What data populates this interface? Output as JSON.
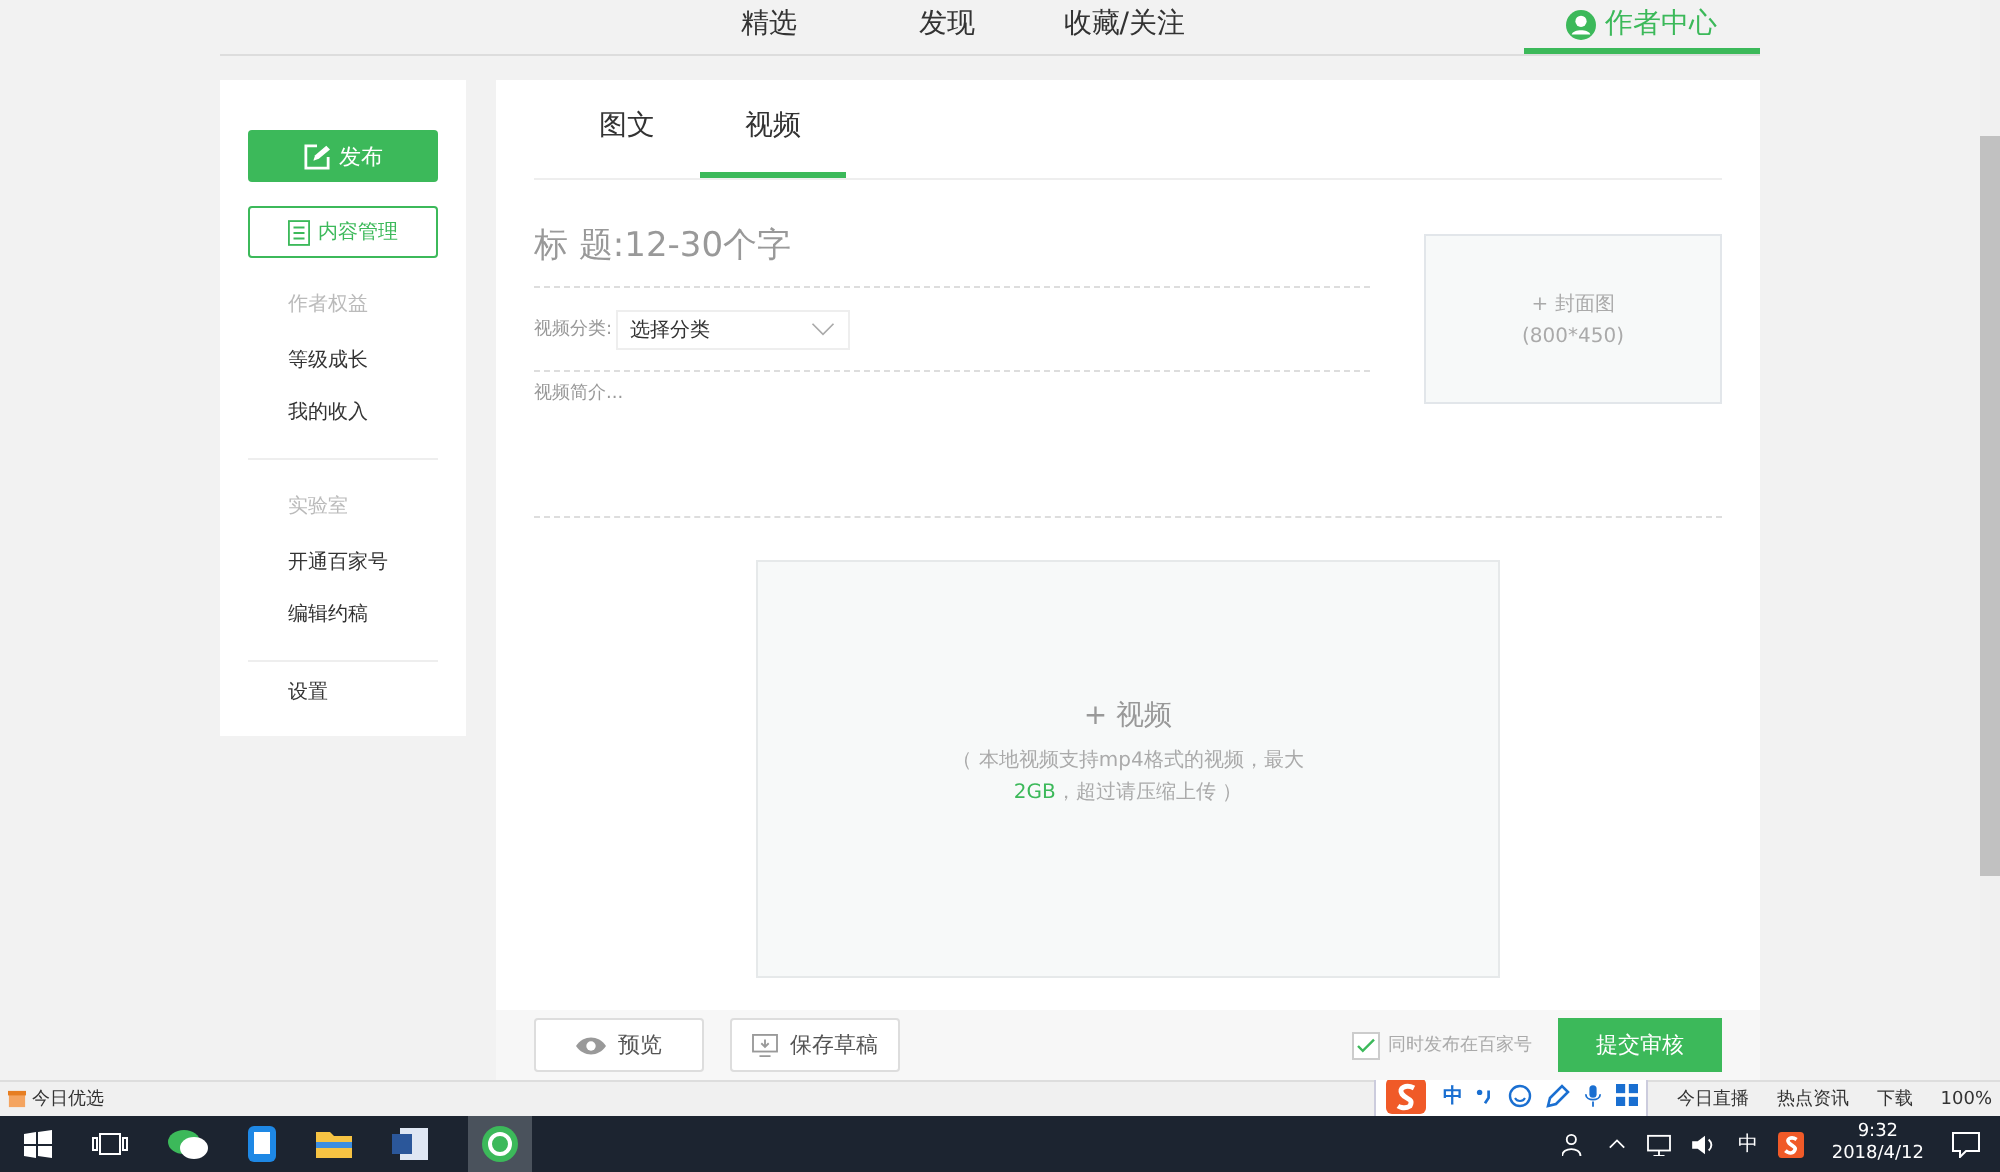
{
  "top_nav": [
    {
      "label": "精选",
      "selected": false
    },
    {
      "label": "发现",
      "selected": false
    },
    {
      "label": "收藏/关注",
      "selected": false
    },
    {
      "label": "作者中心",
      "selected": true
    }
  ],
  "sidebar": {
    "publish_button": "发布",
    "manage_button": "内容管理",
    "groups": [
      {
        "heading": "作者权益",
        "items": [
          "等级成长",
          "我的收入"
        ]
      },
      {
        "heading": "实验室",
        "items": [
          "开通百家号",
          "编辑约稿"
        ]
      },
      {
        "items": [
          "设置"
        ]
      }
    ]
  },
  "editor": {
    "tabs": [
      {
        "label": "图文",
        "selected": false
      },
      {
        "label": "视频",
        "selected": true
      }
    ],
    "title_placeholder": "标 题:12-30个字",
    "category_label": "视频分类:",
    "category_value": "选择分类",
    "summary_placeholder": "视频简介...",
    "cover": {
      "label": "+ 封面图",
      "size": "(800*450)"
    },
    "upload": {
      "label": "+ 视频",
      "hint": "（ 本地视频支持mp4格式的视频，最大**2GB**，超过请压缩上传 ）"
    }
  },
  "actions": {
    "preview": "预览",
    "save_draft": "保存草稿",
    "sync_checkbox": {
      "label": "同时发布在百家号",
      "checked": true
    },
    "submit": "提交审核"
  },
  "browser_status": {
    "left": "今日优选",
    "ime": "中",
    "items": [
      "今日直播",
      "热点资讯",
      "下载"
    ],
    "zoom": "100%"
  },
  "taskbar": {
    "input_indicator": "中",
    "time": "9:32",
    "date": "2018/4/12"
  }
}
